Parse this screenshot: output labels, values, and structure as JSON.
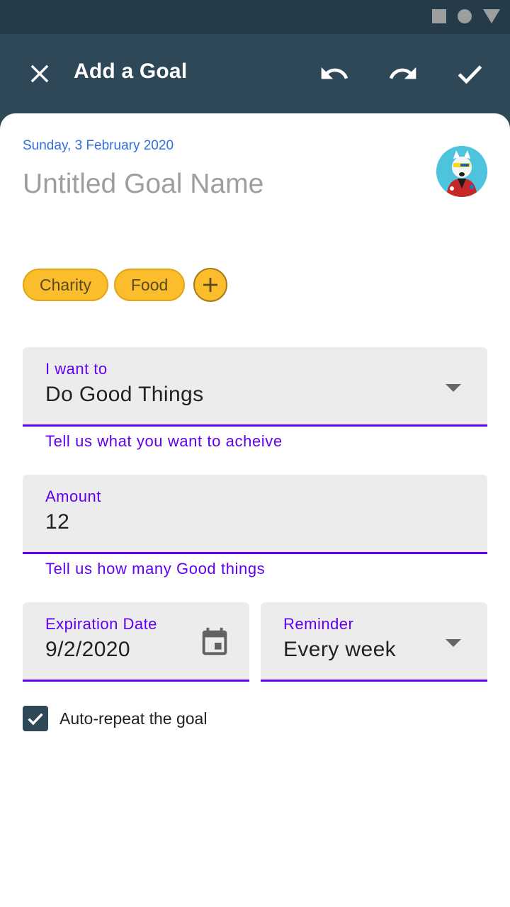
{
  "app_bar": {
    "title": "Add a Goal",
    "icons": [
      "close-icon",
      "undo-icon",
      "redo-icon",
      "check-icon"
    ]
  },
  "goal": {
    "date": "Sunday, 3 February 2020",
    "name_placeholder": "Untitled Goal Name"
  },
  "tags": {
    "items": [
      "Charity",
      "Food"
    ],
    "add_icon": "plus-icon"
  },
  "fields": {
    "want_to": {
      "label": "I want to",
      "value": "Do Good Things",
      "helper": "Tell us what you want to acheive"
    },
    "amount": {
      "label": "Amount",
      "value": "12",
      "helper": "Tell us how many Good things"
    },
    "expiration": {
      "label": "Expiration Date",
      "value": "9/2/2020",
      "icon": "calendar-icon"
    },
    "reminder": {
      "label": "Reminder",
      "value": "Every week"
    }
  },
  "auto_repeat": {
    "label": "Auto-repeat the goal",
    "checked": true
  },
  "colors": {
    "app_bar": "#2f4858",
    "accent": "#6200ee",
    "chip": "#fbbd2b",
    "date": "#2f6fe0"
  }
}
